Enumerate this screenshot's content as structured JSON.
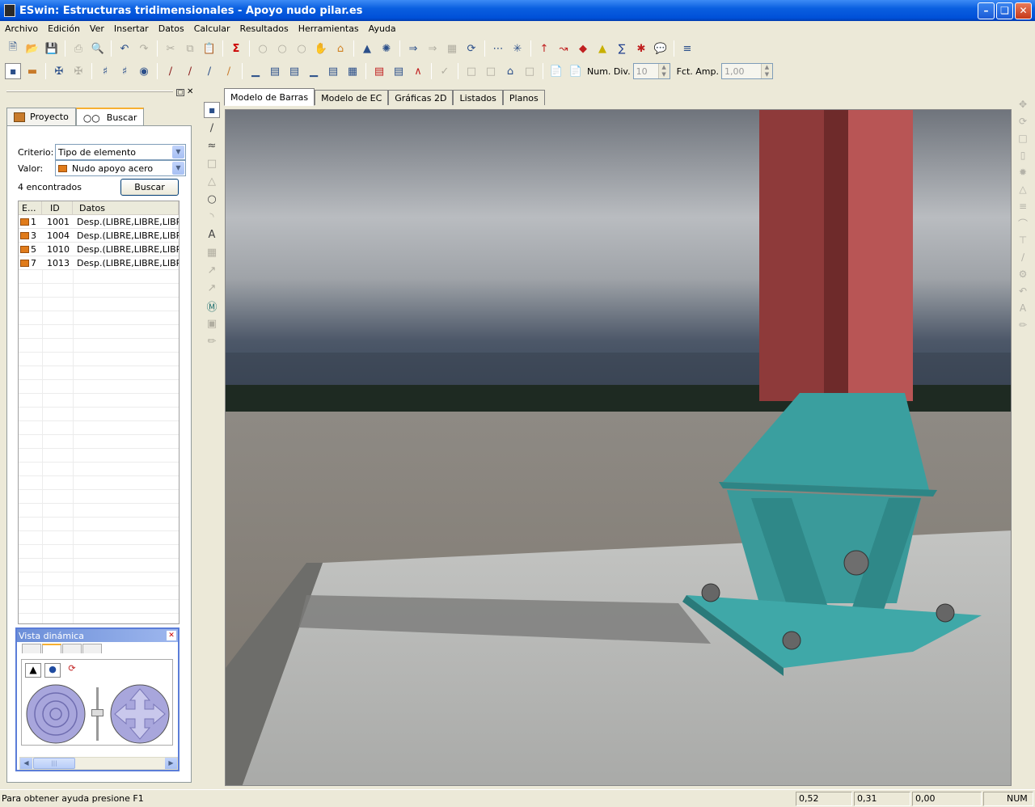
{
  "window": {
    "title": "ESwin: Estructuras tridimensionales - Apoyo nudo pilar.es"
  },
  "menu": [
    "Archivo",
    "Edición",
    "Ver",
    "Insertar",
    "Datos",
    "Calcular",
    "Resultados",
    "Herramientas",
    "Ayuda"
  ],
  "toolbar2": {
    "num_div_label": "Num. Div.",
    "num_div_value": "10",
    "fct_amp_label": "Fct. Amp.",
    "fct_amp_value": "1,00"
  },
  "panel": {
    "tabs": [
      "Proyecto",
      "Buscar"
    ],
    "criterio_label": "Criterio:",
    "criterio_value": "Tipo de elemento",
    "valor_label": "Valor:",
    "valor_value": "Nudo apoyo acero",
    "found_text": "4 encontrados",
    "search_button": "Buscar",
    "columns": [
      "E...",
      "ID",
      "Datos"
    ],
    "rows": [
      {
        "e": "1",
        "id": "1001",
        "datos": "Desp.(LIBRE,LIBRE,LIBRE"
      },
      {
        "e": "3",
        "id": "1004",
        "datos": "Desp.(LIBRE,LIBRE,LIBRE"
      },
      {
        "e": "5",
        "id": "1010",
        "datos": "Desp.(LIBRE,LIBRE,LIBRE"
      },
      {
        "e": "7",
        "id": "1013",
        "datos": "Desp.(LIBRE,LIBRE,LIBRE"
      }
    ]
  },
  "dynamic_view": {
    "title": "Vista dinámica"
  },
  "doc_tabs": [
    "Modelo de Barras",
    "Modelo de EC",
    "Gráficas 2D",
    "Listados",
    "Planos"
  ],
  "status": {
    "message": "Para obtener ayuda presione F1",
    "x": "0,52",
    "y": "0,31",
    "z": "0,00",
    "mode": "NUM"
  },
  "colors": {
    "column": "#b54a4a",
    "base_plate": "#3a9f9f",
    "sky": "#8a9098",
    "ground": "#a09e96"
  }
}
